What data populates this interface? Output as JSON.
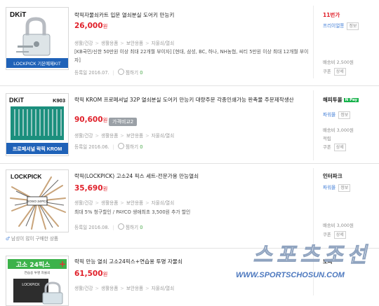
{
  "products": [
    {
      "title": "락픽자물쇠카트 입문 열쇠분실 도어키 만능키",
      "price": "26,000",
      "currency": "원",
      "breadcrumbs": [
        "생활/건강",
        "생활용품",
        "보안용품",
        "자물쇠/열쇠"
      ],
      "description": "[KB국민/신한 50만원 이상 최대 22개월 부이자] [현대, 삼성, BC, 하나, NH농협, 씨티 5만원 이상 최대 12개월 부이자]",
      "registered": "등록일 2016.07.",
      "zzim_label": "찜하기",
      "zzim_count": "0",
      "thumb_brand": "DKiT",
      "thumb_caption": "LOCKPICK 기본예제KIT",
      "seller_name": "11번가",
      "seller_sup": "",
      "seller_sub": "프리이얼쫑",
      "seller_tag": "정보",
      "shipping": "배송비 2,500원",
      "extra_label": "쿠폰",
      "extra_tag": "상세"
    },
    {
      "title": "락픽 KROM 프로페셔널 32P 열쇠분실 도어키 만능키 대량주문 각종인쇄가능 판촉물 주문제작생산",
      "price": "90,600",
      "currency": "원",
      "compare_label": "가격비교2",
      "breadcrumbs": [
        "생활/건강",
        "생활용품",
        "보안용품",
        "자물쇠/열쇠"
      ],
      "registered": "등록일 2016.06.",
      "zzim_label": "찜하기",
      "zzim_count": "0",
      "thumb_brand": "DKiT",
      "thumb_code": "K903",
      "thumb_caption": "프로페셔널 락픽 KROM",
      "seller_name": "해피투몰",
      "seller_badge": "N Pay",
      "seller_sub": "파워몰",
      "seller_tag": "정보",
      "shipping": "배송비 3,000원",
      "extra1": "적립",
      "extra_label": "쿠폰",
      "extra_tag": "상세"
    },
    {
      "title": "락픽(LOCKPICK) 고소24 픽스 세트-전문가용 만능열쇠",
      "price": "35,690",
      "currency": "원",
      "breadcrumbs": [
        "생활/건강",
        "생활용품",
        "보안용품",
        "자물쇠/열쇠"
      ],
      "description": "최대 5% 청구할인 / PAYCO 생애최초 3,500원 추가 할인",
      "registered": "등록일 2016.08.",
      "zzim_label": "찜하기",
      "zzim_count": "0",
      "thumb_brand": "LOCKPICK",
      "thumb_sub": "GOSO 24PCS",
      "seller_name": "인터파크",
      "seller_sub": "파워몰",
      "seller_tag": "정보",
      "shipping": "배송비 3,000원",
      "extra_label": "쿠폰",
      "extra_tag": "상세",
      "ad_note": "남성이 많이 구매한 상품"
    },
    {
      "title": "락픽 만능 열쇠 고소24픽스+연습용 투명 자물쇠",
      "price": "61,500",
      "currency": "원",
      "breadcrumbs": [
        "생활/건강",
        "생활용품",
        "보안용품",
        "자물쇠/열쇠"
      ],
      "thumb_caption": "고소 24픽스",
      "thumb_sub": "연습용 투명 자물쇠",
      "seller_name": "노라"
    }
  ],
  "watermark": {
    "logo": "스포츠조선",
    "url": "WWW.SPORTSCHOSUN.COM"
  },
  "colors": {
    "price": "#e0202a",
    "seller_link": "#3d7bd6",
    "npay": "#17b24b",
    "watermark": "#2b5fb3"
  }
}
